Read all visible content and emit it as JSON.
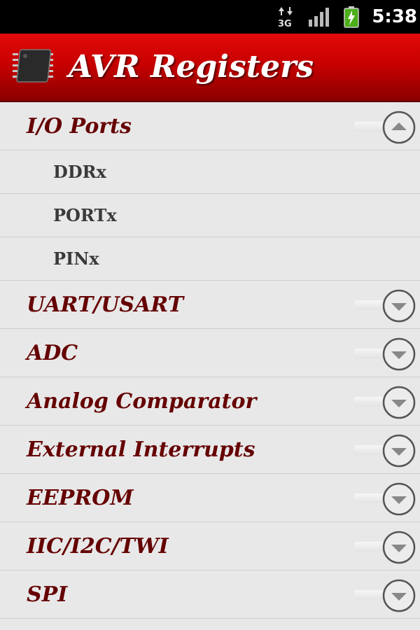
{
  "status_bar": {
    "time": "5:38",
    "network_type": "3G",
    "icons": [
      "data-activity-icon",
      "signal-icon",
      "battery-charging-icon"
    ]
  },
  "header": {
    "title": "AVR Registers",
    "logo_icon": "chip-icon"
  },
  "colors": {
    "header_red": "#c80000",
    "group_text": "#650000",
    "child_text": "#3a3a3a",
    "list_bg": "#e8e8e8"
  },
  "list": {
    "groups": [
      {
        "label": "I/O Ports",
        "expanded": true,
        "children": [
          "DDRx",
          "PORTx",
          "PINx"
        ]
      },
      {
        "label": "UART/USART",
        "expanded": false
      },
      {
        "label": "ADC",
        "expanded": false
      },
      {
        "label": "Analog Comparator",
        "expanded": false
      },
      {
        "label": "External Interrupts",
        "expanded": false
      },
      {
        "label": "EEPROM",
        "expanded": false
      },
      {
        "label": "IIC/I2C/TWI",
        "expanded": false
      },
      {
        "label": "SPI",
        "expanded": false
      }
    ]
  }
}
